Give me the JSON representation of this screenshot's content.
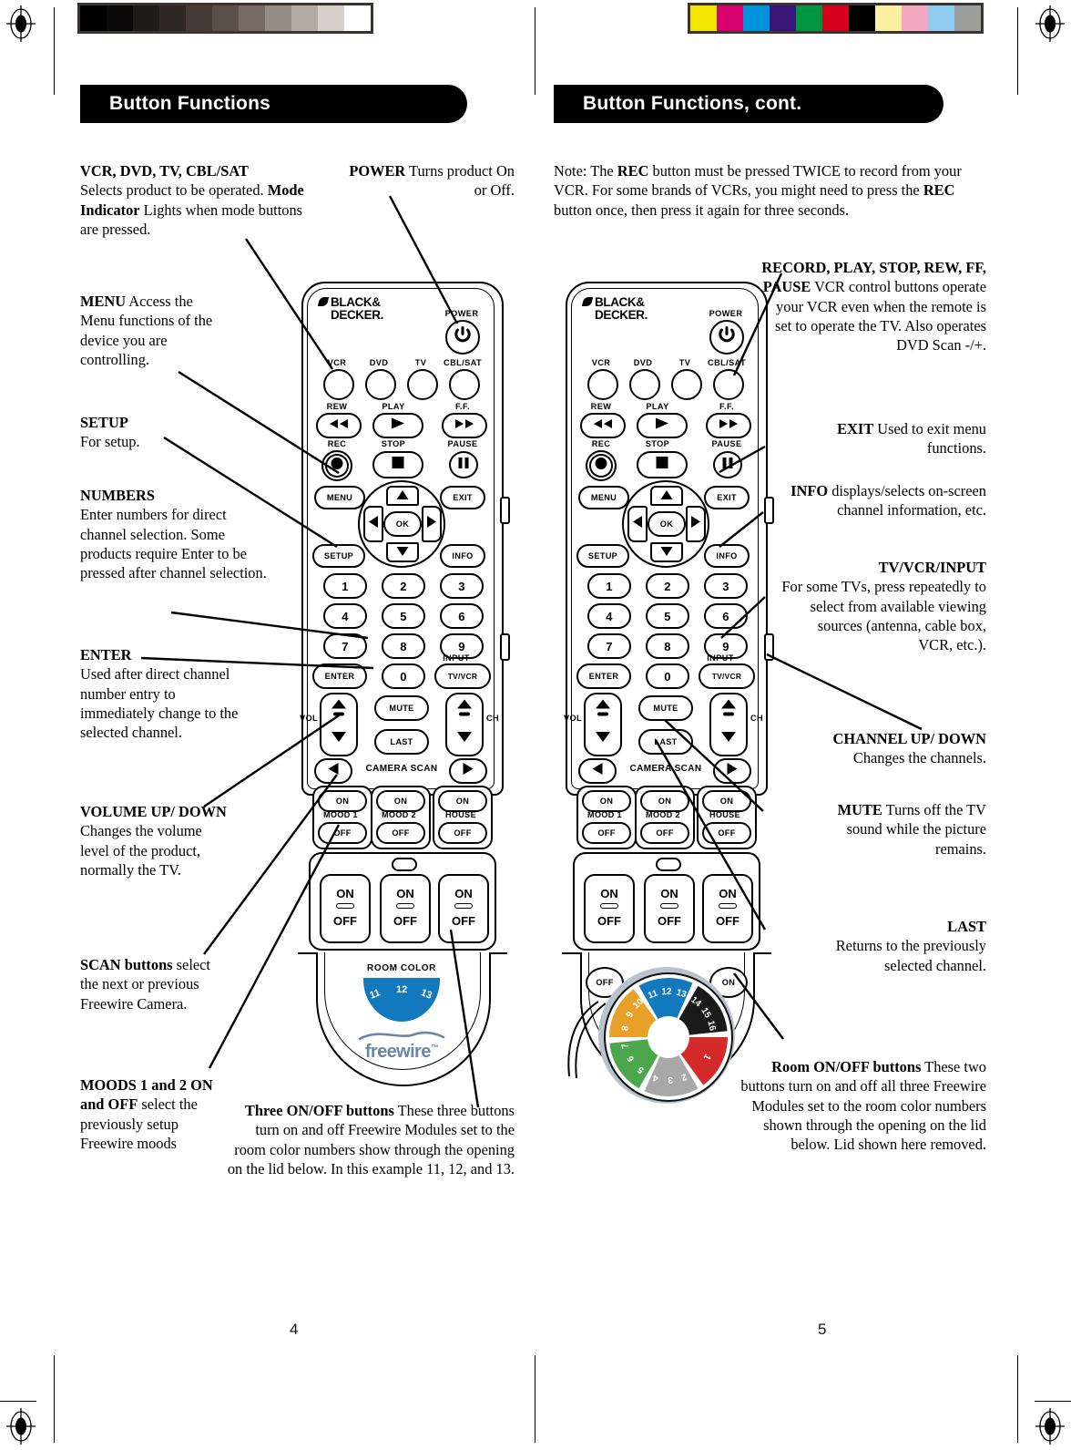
{
  "document": {
    "title": "Black & Decker Freewire Remote Control — Button Functions",
    "spread_pages": [
      "4",
      "5"
    ]
  },
  "print_marks": {
    "grayscale_bar": [
      "#000000",
      "#0b0909",
      "#1f1b1a",
      "#2f2724",
      "#453a35",
      "#5b4f49",
      "#776b64",
      "#958b85",
      "#b3aaa4",
      "#d6d0ca",
      "#ffffff"
    ],
    "color_bar": [
      "#f2e500",
      "#d6006e",
      "#0093dd",
      "#3b1478",
      "#009640",
      "#d4001e",
      "#000000",
      "#fbf0a0",
      "#f2a8c0",
      "#8fccf0",
      "#9d9d9c"
    ]
  },
  "left_page": {
    "number": "4",
    "banner": "Button Functions",
    "callouts": {
      "vcr_dvd_tv_cblsat": {
        "head": "VCR, DVD, TV, CBL/SAT",
        "body": "Selects product to be operated. ",
        "head2": "Mode Indicator",
        "body2": " Lights when mode buttons are pressed."
      },
      "power": {
        "head": "POWER",
        "body": " Turns product On or Off."
      },
      "menu": {
        "head": "MENU",
        "body": " Access the Menu functions of the device you are controlling."
      },
      "setup": {
        "head": "SETUP",
        "body": "For setup."
      },
      "numbers": {
        "head": "NUMBERS",
        "body": "Enter numbers for direct channel selection. Some products require Enter to be pressed after channel selection."
      },
      "enter": {
        "head": "ENTER",
        "body": "Used after direct channel number entry to immediately change to the selected channel."
      },
      "volume": {
        "head": "VOLUME UP/ DOWN",
        "body": " Changes the volume level of the product, normally the TV."
      },
      "scan": {
        "head": "SCAN buttons",
        "body": " select the next or previous Freewire Camera."
      },
      "moods": {
        "head": "MOODS 1 and 2 ON and OFF",
        "body": " select the previously setup Freewire moods"
      },
      "three_onoff": {
        "head": "Three ON/OFF buttons",
        "body": " These three buttons turn on and off Freewire Modules set to the room color numbers show through the opening on the lid below. In this example 11, 12, and 13."
      }
    }
  },
  "right_page": {
    "number": "5",
    "banner": "Button Functions, cont.",
    "note": {
      "p1": "Note: The ",
      "b1": "REC",
      "p2": " button must be pressed TWICE to record from your VCR. For some brands of VCRs, you might need to press the ",
      "b2": "REC",
      "p3": " button once, then press it again for three seconds."
    },
    "callouts": {
      "transport": {
        "head": "RECORD, PLAY, STOP, REW, FF, PAUSE",
        "body": " VCR control buttons operate your VCR even when the remote is set to operate the TV. Also operates DVD Scan -/+."
      },
      "exit": {
        "head": "EXIT",
        "body": " Used to exit menu functions."
      },
      "info": {
        "head": "INFO",
        "body": " displays/selects on-screen channel information, etc."
      },
      "tv_vcr_input": {
        "head": "TV/VCR/INPUT",
        "body": " For some TVs, press repeatedly to select from available viewing sources (antenna, cable box, VCR, etc.)."
      },
      "channel": {
        "head": "CHANNEL UP/ DOWN",
        "body": " Changes the channels."
      },
      "mute": {
        "head": "MUTE",
        "body": " Turns off the TV sound while the picture remains."
      },
      "last": {
        "head": "LAST",
        "body": "Returns to the previously selected channel."
      },
      "room_onoff": {
        "head": "Room ON/OFF buttons",
        "body": " These two buttons turn on and off all three Freewire Modules set to the room color numbers shown through the opening on the lid below. Lid shown here removed."
      }
    }
  },
  "remote": {
    "brand_line1": "BLACK&",
    "brand_line2": "DECKER.",
    "power_label": "POWER",
    "mode_buttons": [
      "VCR",
      "DVD",
      "TV",
      "CBL/SAT"
    ],
    "transport_row1": [
      "REW",
      "PLAY",
      "F.F."
    ],
    "transport_row2": [
      "REC",
      "STOP",
      "PAUSE"
    ],
    "menu_label": "MENU",
    "exit_label": "EXIT",
    "ok_label": "OK",
    "setup_label": "SETUP",
    "info_label": "INFO",
    "keypad": [
      "1",
      "2",
      "3",
      "4",
      "5",
      "6",
      "7",
      "8",
      "9"
    ],
    "enter_label": "ENTER",
    "zero_label": "0",
    "input_label": "INPUT",
    "tvvcr_label": "TV/VCR",
    "vol_label": "VOL",
    "ch_label": "CH",
    "mute_label": "MUTE",
    "last_label": "LAST",
    "camera_scan_label": "CAMERA SCAN",
    "mood_blocks": [
      {
        "on": "ON",
        "name": "MOOD 1",
        "off": "OFF"
      },
      {
        "on": "ON",
        "name": "MOOD 2",
        "off": "OFF"
      },
      {
        "on": "ON",
        "name": "HOUSE",
        "off": "OFF"
      }
    ],
    "lid_blocks": [
      {
        "on": "ON",
        "off": "OFF"
      },
      {
        "on": "ON",
        "off": "OFF"
      },
      {
        "on": "ON",
        "off": "OFF"
      }
    ],
    "room_color_label": "ROOM COLOR",
    "room_color_window_numbers": [
      "11",
      "12",
      "13"
    ],
    "freewire_logo": "freewire",
    "freewire_tm": "™",
    "room_off_label": "OFF",
    "room_on_label": "ON"
  },
  "color_wheel": {
    "segments": [
      {
        "name": "blue",
        "color": "#1279be",
        "numbers": [
          "11",
          "12",
          "13"
        ]
      },
      {
        "name": "black",
        "color": "#1a1a1a",
        "numbers": [
          "14",
          "15",
          "16"
        ]
      },
      {
        "name": "red",
        "color": "#d42a2a",
        "numbers": [
          "1"
        ]
      },
      {
        "name": "gray",
        "color": "#a8a8a8",
        "numbers": [
          "2",
          "3",
          "4"
        ]
      },
      {
        "name": "green",
        "color": "#4ca64c",
        "numbers": [
          "5",
          "6",
          "7"
        ]
      },
      {
        "name": "orange",
        "color": "#e8a029",
        "numbers": [
          "8",
          "9",
          "10"
        ]
      }
    ]
  },
  "colors": {
    "banner_bg": "#000000",
    "banner_text": "#ffffff",
    "room_color_blue": "#1279be",
    "freewire_logo": "#6a86a8",
    "wheel_rim": "#b9c2cf"
  }
}
